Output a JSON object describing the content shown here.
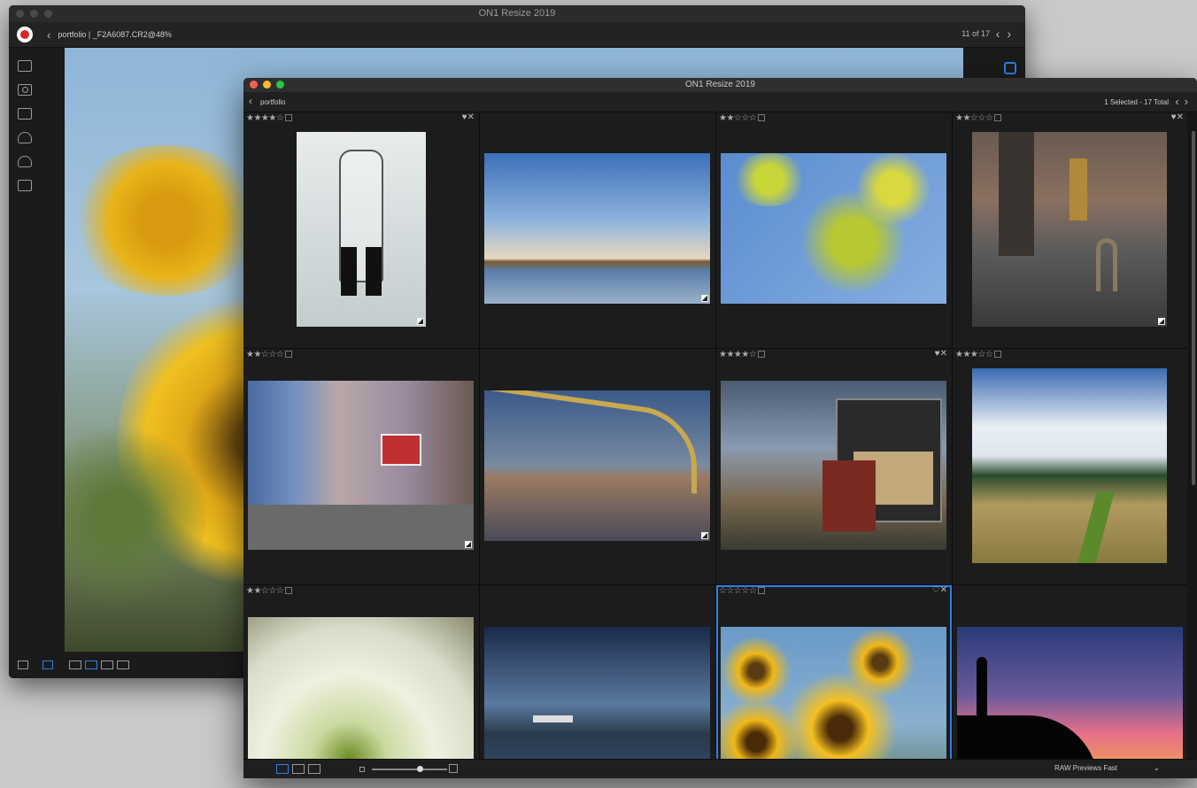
{
  "back_window": {
    "title": "ON1 Resize 2019",
    "breadcrumb": "portfolio | _F2A6087.CR2@48%",
    "counter": "11 of 17",
    "prev_label": "<",
    "next_label": ">",
    "sidebar_icons": [
      "monitor-icon",
      "camera-icon",
      "folder-search-icon",
      "drive-icon",
      "cloud-icon",
      "albums-icon"
    ],
    "bottom_icons": [
      "user-icon",
      "help-icon"
    ]
  },
  "front_window": {
    "title": "ON1 Resize 2019",
    "breadcrumb": "portfolio",
    "selection": "1 Selected - 17 Total",
    "prev_label": "<",
    "next_label": ">",
    "thumbnails": [
      {
        "rating": "★★★★☆",
        "favorite": "♥✕",
        "subject": "light bulb"
      },
      {
        "rating": "",
        "favorite": "",
        "subject": "lake sunset"
      },
      {
        "rating": "★★☆☆☆",
        "favorite": "",
        "subject": "green leaves"
      },
      {
        "rating": "★★☆☆☆",
        "favorite": "♥✕",
        "subject": "sidewalk posts"
      },
      {
        "rating": "★★☆☆☆",
        "favorite": "",
        "subject": "cafe interior"
      },
      {
        "rating": "",
        "favorite": "",
        "subject": "bridge"
      },
      {
        "rating": "★★★★☆",
        "favorite": "♥✕",
        "subject": "building"
      },
      {
        "rating": "★★★☆☆",
        "favorite": "",
        "subject": "field"
      },
      {
        "rating": "★★☆☆☆",
        "favorite": "",
        "subject": "white flower"
      },
      {
        "rating": "",
        "favorite": "",
        "subject": "river boat"
      },
      {
        "rating": "☆☆☆☆☆",
        "favorite": "♡✕",
        "subject": "sunflowers",
        "selected": true
      },
      {
        "rating": "",
        "favorite": "",
        "subject": "silhouette sunset"
      }
    ],
    "raw_previews_label": "RAW Previews",
    "raw_previews_value": "Fast",
    "raw_previews_chevron": "⌄"
  },
  "colors": {
    "accent": "#2f7fe6",
    "bg": "#1c1c1c"
  }
}
